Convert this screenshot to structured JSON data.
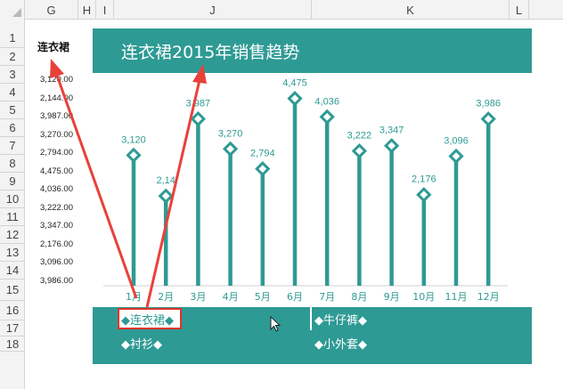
{
  "columns": [
    "G",
    "H",
    "I",
    "J",
    "K",
    "L"
  ],
  "rows": [
    "1",
    "2",
    "3",
    "4",
    "5",
    "6",
    "7",
    "8",
    "9",
    "10",
    "11",
    "12",
    "13",
    "14",
    "15",
    "16",
    "17",
    "18"
  ],
  "g_column": {
    "header": "连衣裙",
    "values": [
      "3,120.00",
      "2,144.00",
      "3,987.00",
      "3,270.00",
      "2,794.00",
      "4,475.00",
      "4,036.00",
      "3,222.00",
      "3,347.00",
      "2,176.00",
      "3,096.00",
      "3,986.00"
    ]
  },
  "chart_data": {
    "type": "line",
    "title": "连衣裙2015年销售趋势",
    "categories": [
      "1月",
      "2月",
      "3月",
      "4月",
      "5月",
      "6月",
      "7月",
      "8月",
      "9月",
      "10月",
      "11月",
      "12月"
    ],
    "series": [
      {
        "name": "连衣裙",
        "values": [
          3120,
          2144,
          3987,
          3270,
          2794,
          4475,
          4036,
          3222,
          3347,
          2176,
          3096,
          3986
        ]
      }
    ],
    "data_labels": [
      "3,120",
      "2,14",
      "3,987",
      "3,270",
      "2,794",
      "4,475",
      "4,036",
      "3,222",
      "3,347",
      "2,176",
      "3,096",
      "3,986"
    ],
    "ylim": [
      0,
      5000
    ],
    "grid": false,
    "color": "#2e9a94",
    "legend_placement": "bottom"
  },
  "legend": {
    "items": [
      "◆连衣裙◆",
      "◆牛仔裤◆",
      "◆衬衫◆",
      "◆小外套◆"
    ]
  },
  "colors": {
    "accent": "#2e9a94",
    "highlight": "#e0352b",
    "arrow": "#e8413a"
  }
}
